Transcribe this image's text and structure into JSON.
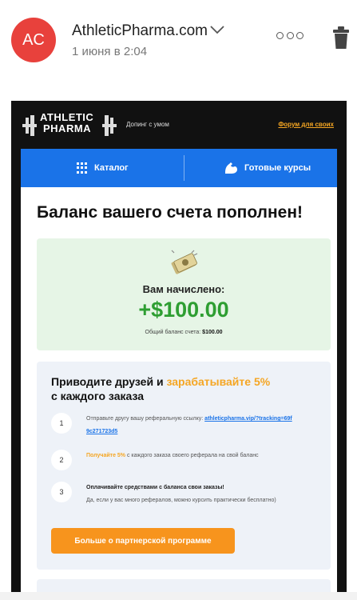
{
  "mail": {
    "avatar_initials": "AC",
    "avatar_color": "#e8413c",
    "sender": "AthleticPharma.com",
    "date": "1 июня в 2:04"
  },
  "brand": {
    "logo_line1": "ATHLETIC",
    "logo_line2": "PHARMA",
    "tagline": "Допинг с умом",
    "forum_link": "Форум для своих"
  },
  "nav": {
    "catalog": "Каталог",
    "courses": "Готовые курсы",
    "color": "#1a73e8"
  },
  "headline": "Баланс вашего счета пополнен!",
  "credit": {
    "label": "Вам начислено:",
    "amount": "+$100.00",
    "balance_label": "Общий баланс счета:",
    "balance_value": "$100.00"
  },
  "referral": {
    "title_start": "Приводите друзей и ",
    "title_highlight": "зарабатывайте 5%",
    "title_end": "с каждого заказа",
    "steps": [
      {
        "num": "1",
        "text": "Отправьте другу вашу реферальную ссылку: ",
        "link": "athleticpharma.vip/?tracking=69f9c271723d5"
      },
      {
        "num": "2",
        "highlight": "Получайте 5%",
        "text": " с каждого заказа своего реферала на свой баланс"
      },
      {
        "num": "3",
        "bold": "Оплачивайте средствами с баланса свои заказы!",
        "text": "Да, если у вас много рефералов, можно курсить практически бесплатно)"
      }
    ],
    "button": "Больше о партнерской программе"
  }
}
